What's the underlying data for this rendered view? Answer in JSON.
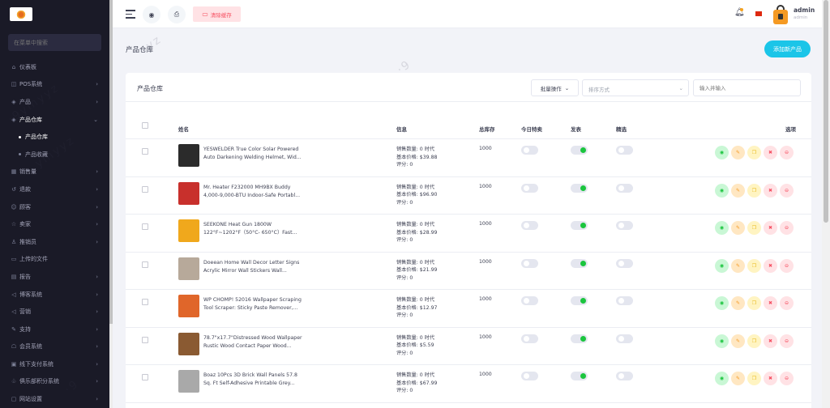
{
  "sidebar": {
    "search_placeholder": "在菜单中搜索",
    "items": [
      {
        "icon": "⌂",
        "label": "仪表板",
        "chev": ""
      },
      {
        "icon": "◫",
        "label": "POS系统",
        "chev": "›"
      },
      {
        "icon": "◈",
        "label": "产品",
        "chev": "›"
      },
      {
        "icon": "◈",
        "label": "产品仓库",
        "chev": "⌄",
        "active": true
      },
      {
        "label": "产品仓库",
        "sub": true,
        "current": true
      },
      {
        "label": "产品收藏",
        "sub": true
      },
      {
        "icon": "▦",
        "label": "销售量",
        "chev": "›"
      },
      {
        "icon": "↺",
        "label": "退款",
        "chev": "›"
      },
      {
        "icon": "☺",
        "label": "顾客",
        "chev": "›"
      },
      {
        "icon": "☆",
        "label": "卖家",
        "chev": "›"
      },
      {
        "icon": "♙",
        "label": "推销员",
        "chev": "›"
      },
      {
        "icon": "▭",
        "label": "上传的文件",
        "chev": ""
      },
      {
        "icon": "▤",
        "label": "报告",
        "chev": "›"
      },
      {
        "icon": "◁",
        "label": "博客系统",
        "chev": "›"
      },
      {
        "icon": "◁",
        "label": "营销",
        "chev": "›"
      },
      {
        "icon": "✎",
        "label": "支持",
        "chev": "›"
      },
      {
        "icon": "☖",
        "label": "会员系统",
        "chev": "›"
      },
      {
        "icon": "▣",
        "label": "线下支付系统",
        "chev": "›"
      },
      {
        "icon": "♧",
        "label": "俱乐部积分系统",
        "chev": "›"
      },
      {
        "icon": "▢",
        "label": "网站设置",
        "chev": "›"
      }
    ]
  },
  "topbar": {
    "clear_cache": "清除缓存",
    "user_name": "admin",
    "user_role": "admin"
  },
  "page": {
    "title": "产品仓库",
    "add_button": "添加新产品"
  },
  "card": {
    "title": "产品仓库",
    "bulk_action": "批量操作",
    "sort_placeholder": "排序方式",
    "search_placeholder": "输入并输入"
  },
  "table": {
    "headers": {
      "name": "姓名",
      "info": "信息",
      "stock": "总库存",
      "todays_deal": "今日特卖",
      "published": "发表",
      "featured": "精选",
      "options": "选项"
    },
    "rows": [
      {
        "name1": "YESWELDER True Color Solar Powered",
        "name2": "Auto Darkening Welding Helmet, Wid...",
        "sales": "销售数量: 0 时代",
        "price": "基本价格: $39.88",
        "rating": "评分: 0",
        "stock": "1000",
        "deal": false,
        "published": true,
        "featured": false,
        "thumb_color": "#2b2b2b"
      },
      {
        "name1": "Mr. Heater F232000 MH9BX Buddy",
        "name2": "4,000-9,000-BTU Indoor-Safe Portabl...",
        "sales": "销售数量: 0 时代",
        "price": "基本价格: $96.90",
        "rating": "评分: 0",
        "stock": "1000",
        "deal": false,
        "published": true,
        "featured": false,
        "thumb_color": "#c8302c"
      },
      {
        "name1": "SEEKONE Heat Gun 1800W",
        "name2": "122°F~1202°F（50°C- 650°C）Fast...",
        "sales": "销售数量: 0 时代",
        "price": "基本价格: $28.99",
        "rating": "评分: 0",
        "stock": "1000",
        "deal": false,
        "published": true,
        "featured": false,
        "thumb_color": "#f0a81c"
      },
      {
        "name1": "Doeean Home Wall Decor Letter Signs",
        "name2": "Acrylic Mirror Wall Stickers Wall...",
        "sales": "销售数量: 0 时代",
        "price": "基本价格: $21.99",
        "rating": "评分: 0",
        "stock": "1000",
        "deal": false,
        "published": true,
        "featured": false,
        "thumb_color": "#b7a99a"
      },
      {
        "name1": "WP CHOMP! 52016 Wallpaper Scraping",
        "name2": "Tool Scraper: Sticky Paste Remover,...",
        "sales": "销售数量: 0 时代",
        "price": "基本价格: $12.97",
        "rating": "评分: 0",
        "stock": "1000",
        "deal": false,
        "published": true,
        "featured": false,
        "thumb_color": "#e0662a"
      },
      {
        "name1": "78.7\"x17.7\"Distressed Wood Wallpaper",
        "name2": "Rustic Wood Contact Paper Wood...",
        "sales": "销售数量: 0 时代",
        "price": "基本价格: $5.59",
        "rating": "评分: 0",
        "stock": "1000",
        "deal": false,
        "published": true,
        "featured": false,
        "thumb_color": "#8a5a32"
      },
      {
        "name1": "Boaz 10Pcs 3D Brick Wall Panels 57.8",
        "name2": "Sq. Ft Self-Adhesive Printable Grey...",
        "sales": "销售数量: 0 时代",
        "price": "基本价格: $67.99",
        "rating": "评分: 0",
        "stock": "1000",
        "deal": false,
        "published": true,
        "featured": false,
        "thumb_color": "#a9a9a9"
      }
    ]
  },
  "colors": {
    "sidebar_bg": "#1a1a27",
    "accent": "#1bc5e8",
    "toggle_on": "#1bc53e"
  }
}
